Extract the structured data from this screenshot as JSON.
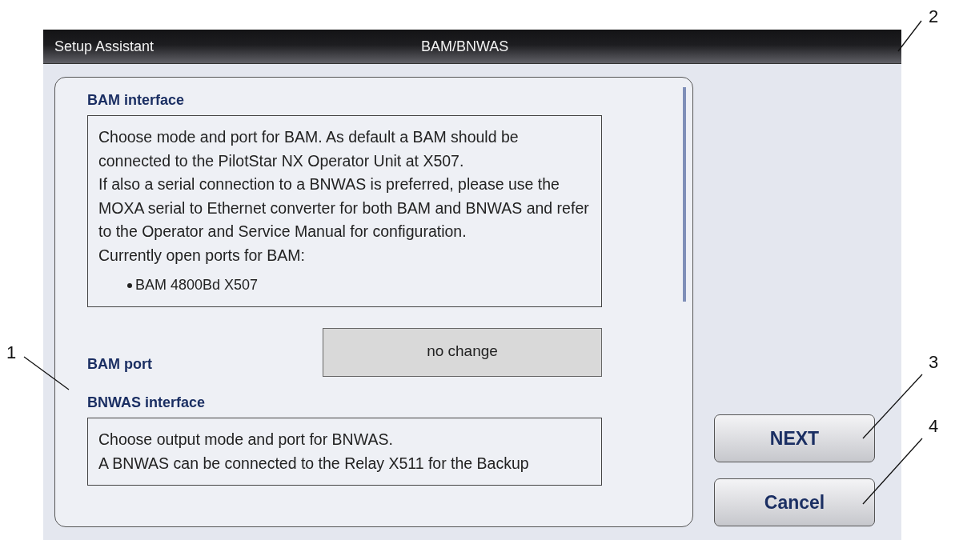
{
  "window": {
    "title": "Setup Assistant",
    "subtitle": "BAM/BNWAS"
  },
  "sections": [
    {
      "kind": "info",
      "heading": "BAM interface",
      "paragraphs": [
        "Choose mode and port for BAM. As default a BAM should be connected to the PilotStar NX Operator Unit at X507.",
        "If also a serial connection to a BNWAS is preferred, please use the MOXA serial to Ethernet converter for both BAM and BNWAS and refer to the Operator and Service Manual for configuration.",
        "Currently open ports for BAM:"
      ],
      "bullets": [
        "BAM 4800Bd X507"
      ]
    },
    {
      "kind": "select",
      "label": "BAM port",
      "value": "no change"
    },
    {
      "kind": "info",
      "heading": "BNWAS interface",
      "paragraphs": [
        "Choose output mode and port for BNWAS.",
        "A BNWAS can be connected to the Relay X511 for the Backup"
      ]
    }
  ],
  "buttons": [
    "NEXT",
    "Cancel"
  ],
  "callouts": [
    "1",
    "2",
    "3",
    "4"
  ]
}
